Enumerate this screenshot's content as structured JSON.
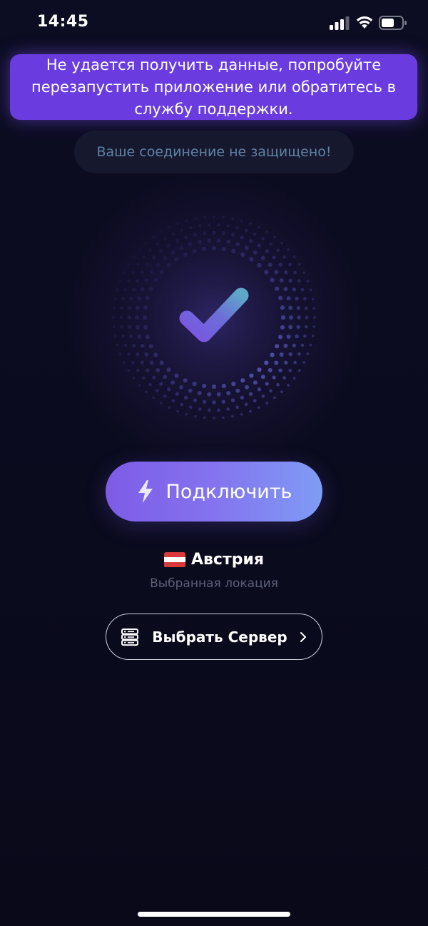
{
  "status_bar": {
    "time": "14:45"
  },
  "error_banner": {
    "message": "Не удается получить данные, попробуйте перезапустить приложение или обратитесь в службу поддержки."
  },
  "connection_status": {
    "text": "Ваше соединение не защищено!"
  },
  "connect_button": {
    "label": "Подключить"
  },
  "location": {
    "name": "Австрия",
    "caption": "Выбранная локация",
    "flag_colors": [
      "#d83a3a",
      "#ffffff",
      "#d83a3a"
    ]
  },
  "server_button": {
    "label": "Выбрать Сервер"
  },
  "icons": {
    "status": [
      "signal-icon",
      "wifi-icon",
      "battery-icon"
    ],
    "center": "checkmark-icon",
    "connect": "bolt-icon",
    "server": "server-icon",
    "chevron": "chevron-right-icon"
  },
  "colors": {
    "background": "#0b0b1f",
    "banner": "#6a3ce0",
    "accent_gradient_start": "#7d5ce6",
    "accent_gradient_end": "#7f9cf5",
    "insecure_text": "#5f82a6"
  }
}
